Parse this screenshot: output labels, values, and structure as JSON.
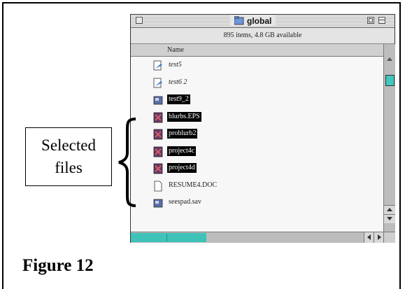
{
  "window": {
    "title": "global",
    "info": "895 items, 4.8 GB available",
    "column_name": "Name"
  },
  "files": [
    {
      "name": "test5",
      "icon": "document-icon",
      "selected": false
    },
    {
      "name": "test6 2",
      "icon": "document-icon",
      "selected": false
    },
    {
      "name": "test9_2",
      "icon": "application-icon",
      "selected": true
    },
    {
      "name": "blurbs.EPS",
      "icon": "eps-file-icon",
      "selected": true
    },
    {
      "name": "problurb2",
      "icon": "eps-file-icon",
      "selected": true
    },
    {
      "name": "project4c",
      "icon": "eps-file-icon",
      "selected": true
    },
    {
      "name": "project4d",
      "icon": "eps-file-icon",
      "selected": true
    },
    {
      "name": "RESUME4.DOC",
      "icon": "blank-document-icon",
      "selected": false
    },
    {
      "name": "seespad.sav",
      "icon": "application-icon",
      "selected": false
    }
  ],
  "callout": {
    "line1": "Selected",
    "line2": "files"
  },
  "figure_label": "Figure 12",
  "colors": {
    "selection": "#000000",
    "scroll_accent": "#3fc3b8"
  }
}
